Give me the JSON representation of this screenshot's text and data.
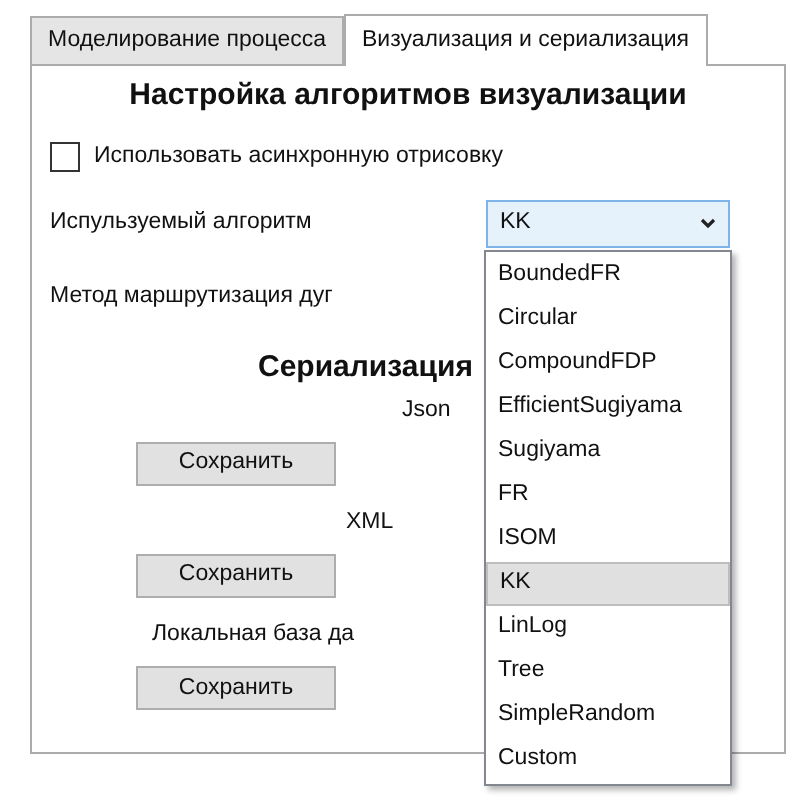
{
  "tabs": [
    {
      "label": "Моделирование процесса",
      "selected": false
    },
    {
      "label": "Визуализация и сериализация",
      "selected": true
    }
  ],
  "settings": {
    "title": "Настройка алгоритмов визуализации",
    "async_render": {
      "label": "Использовать асинхронную отрисовку",
      "checked": false
    },
    "algorithm": {
      "label": "Испульзуемый алгоритм",
      "value": "KK",
      "expanded": true,
      "options": [
        {
          "label": "BoundedFR",
          "selected": false
        },
        {
          "label": "Circular",
          "selected": false
        },
        {
          "label": "CompoundFDP",
          "selected": false
        },
        {
          "label": "EfficientSugiyama",
          "selected": false
        },
        {
          "label": "Sugiyama",
          "selected": false
        },
        {
          "label": "FR",
          "selected": false
        },
        {
          "label": "ISOM",
          "selected": false
        },
        {
          "label": "KK",
          "selected": true
        },
        {
          "label": "LinLog",
          "selected": false
        },
        {
          "label": "Tree",
          "selected": false
        },
        {
          "label": "SimpleRandom",
          "selected": false
        },
        {
          "label": "Custom",
          "selected": false
        }
      ]
    },
    "edge_routing": {
      "label": "Метод маршрутизация дуг"
    }
  },
  "serialization": {
    "title": "Сериализация",
    "targets": [
      {
        "label": "Json",
        "button": "Сохранить"
      },
      {
        "label": "XML",
        "button": "Сохранить"
      },
      {
        "label": "Локальная база да",
        "button": "Сохранить"
      }
    ]
  }
}
